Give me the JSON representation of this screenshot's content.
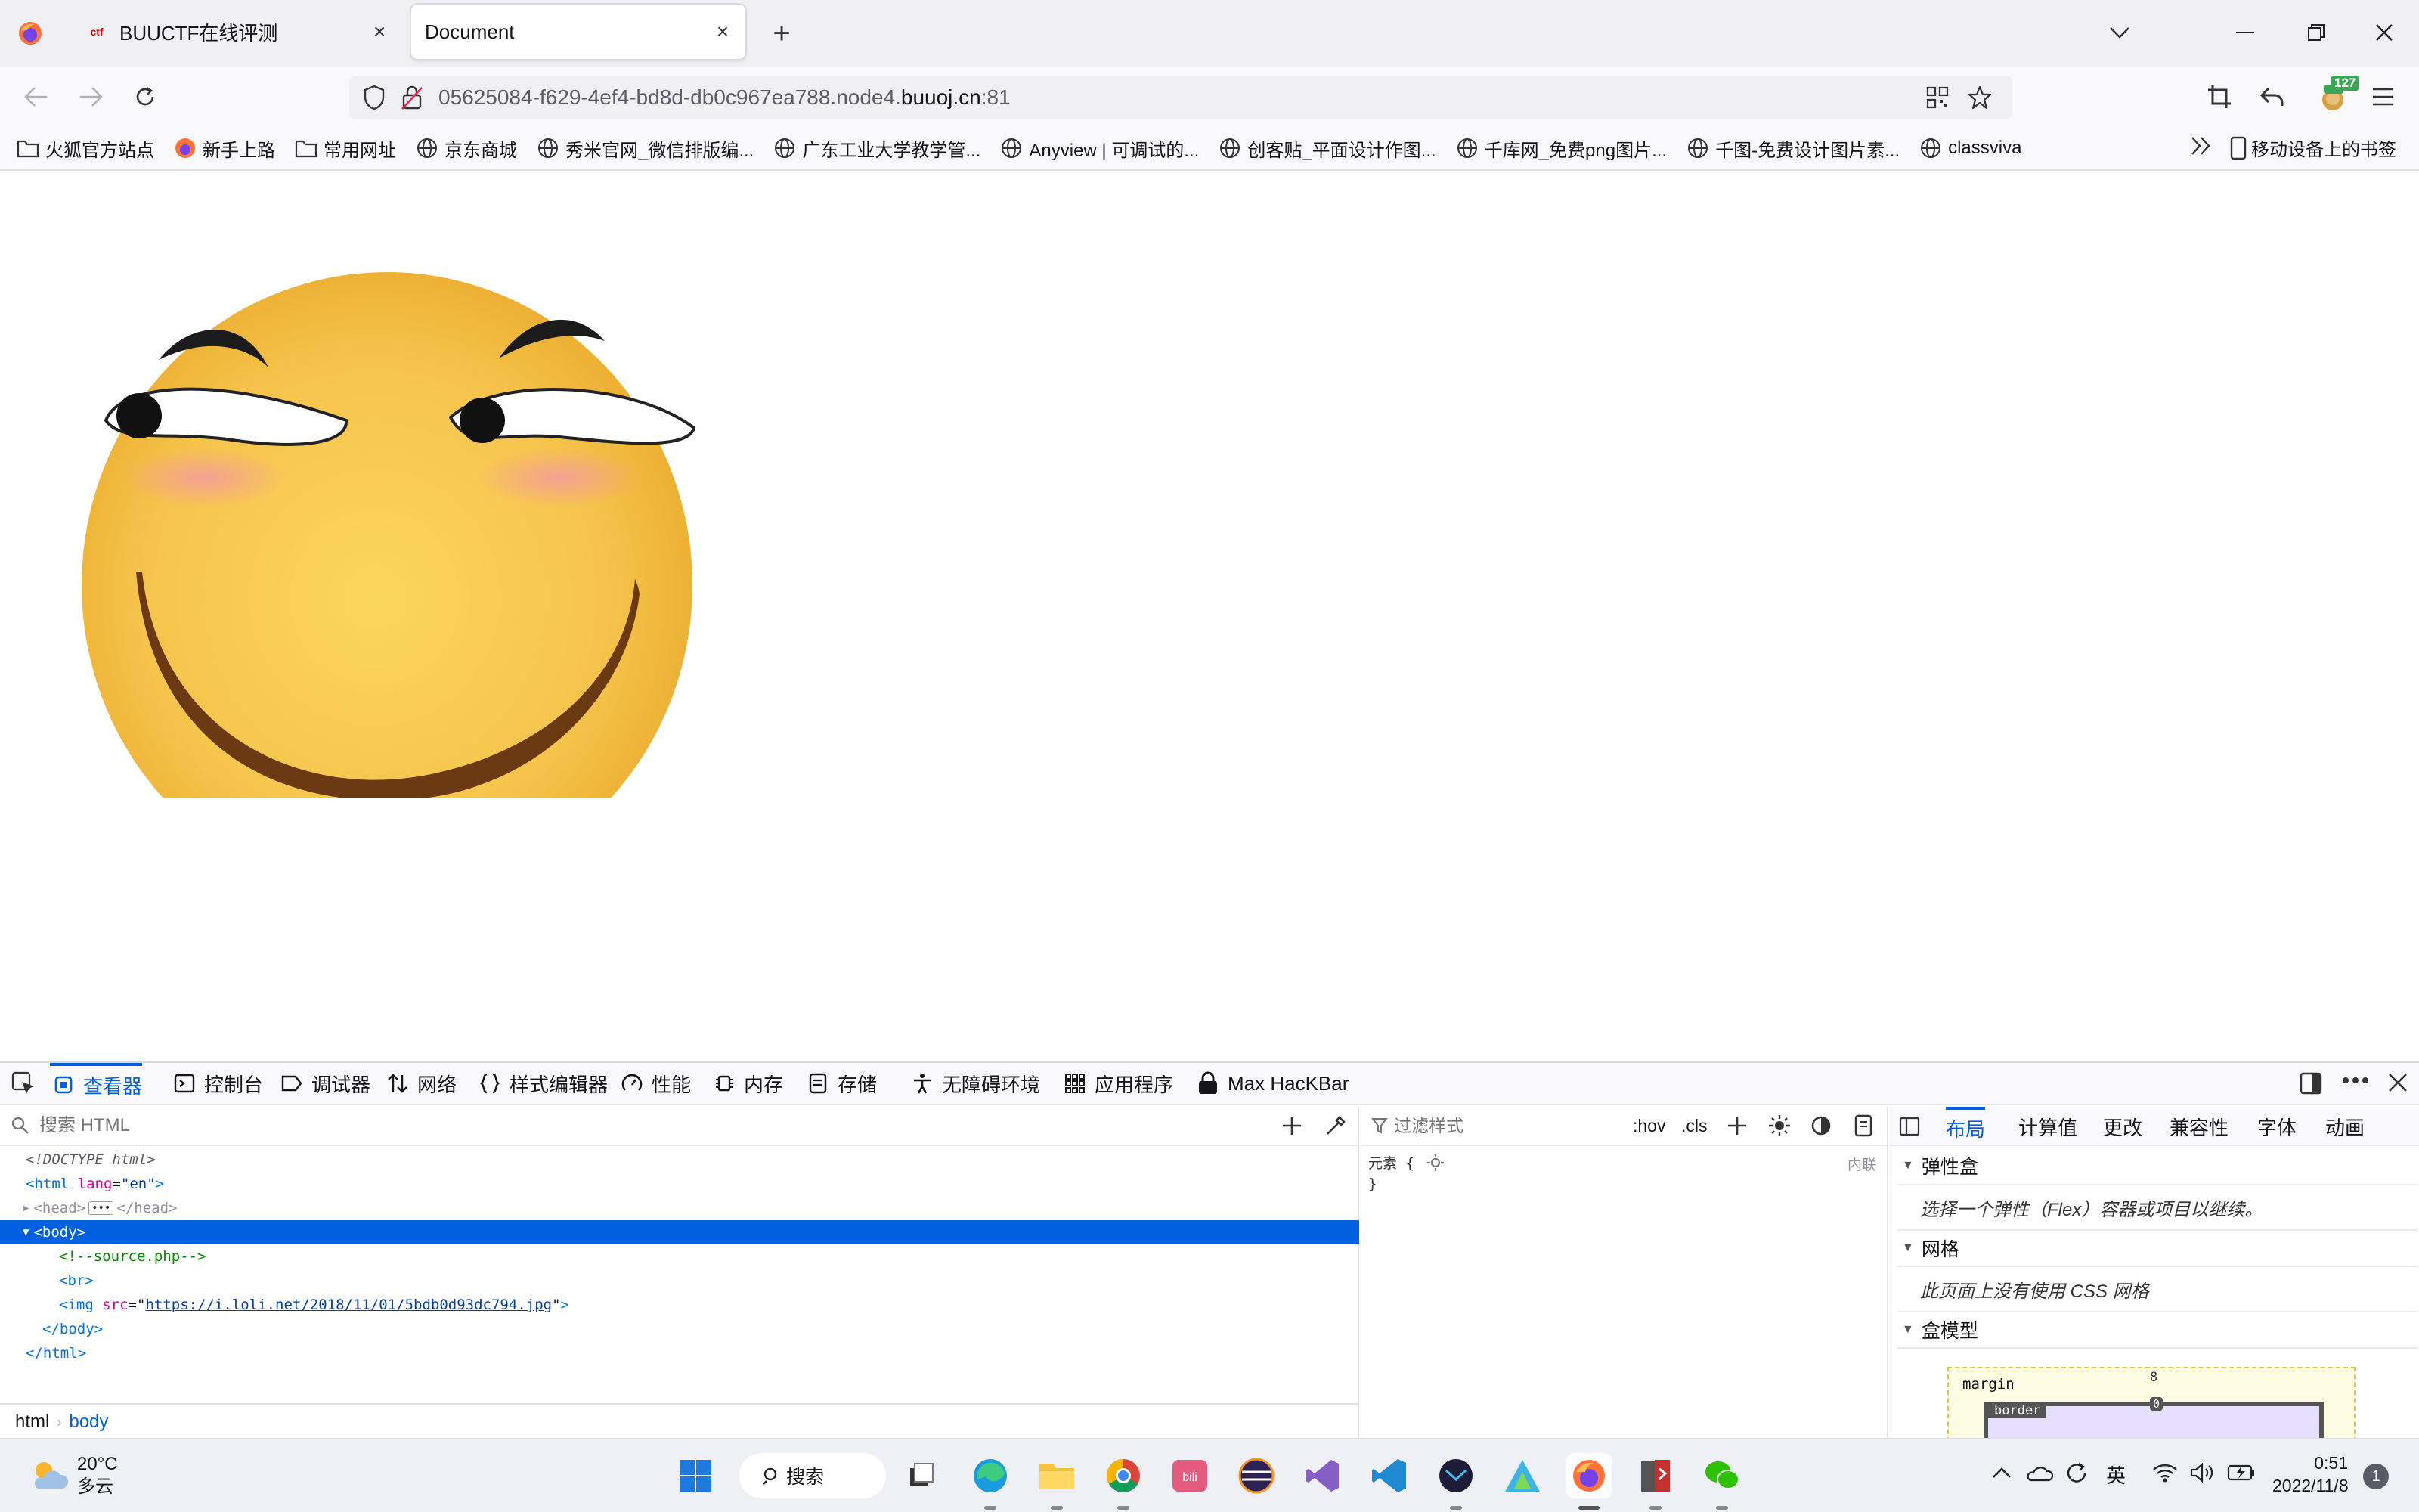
{
  "browser": {
    "tabs": [
      {
        "title": "BUUCTF在线评测",
        "active": false
      },
      {
        "title": "Document",
        "active": true
      }
    ],
    "url": {
      "prefix": "05625084-f629-4ef4-bd8d-db0c967ea788.node4.",
      "domain": "buuoj.cn",
      "port": ":81"
    },
    "extension_badge": "127",
    "bookmarks": [
      {
        "label": "火狐官方站点",
        "icon": "folder-icon"
      },
      {
        "label": "新手上路",
        "icon": "firefox-icon"
      },
      {
        "label": "常用网址",
        "icon": "folder-icon"
      },
      {
        "label": "京东商城",
        "icon": "globe-icon"
      },
      {
        "label": "秀米官网_微信排版编...",
        "icon": "globe-icon"
      },
      {
        "label": "广东工业大学教学管...",
        "icon": "globe-icon"
      },
      {
        "label": "Anyview | 可调试的...",
        "icon": "globe-icon"
      },
      {
        "label": "创客贴_平面设计作图...",
        "icon": "globe-icon"
      },
      {
        "label": "千库网_免费png图片...",
        "icon": "globe-icon"
      },
      {
        "label": "千图-免费设计图片素...",
        "icon": "globe-icon"
      },
      {
        "label": "classviva",
        "icon": "globe-icon"
      }
    ],
    "mobile_bookmarks": "移动设备上的书签"
  },
  "devtools": {
    "tabs": [
      {
        "label": "查看器",
        "icon": "inspector-icon",
        "active": true
      },
      {
        "label": "控制台",
        "icon": "console-icon"
      },
      {
        "label": "调试器",
        "icon": "debugger-icon"
      },
      {
        "label": "网络",
        "icon": "network-icon"
      },
      {
        "label": "样式编辑器",
        "icon": "braces-icon"
      },
      {
        "label": "性能",
        "icon": "gauge-icon"
      },
      {
        "label": "内存",
        "icon": "chip-icon"
      },
      {
        "label": "存储",
        "icon": "storage-icon"
      },
      {
        "label": "无障碍环境",
        "icon": "accessibility-icon"
      },
      {
        "label": "应用程序",
        "icon": "grid-icon"
      },
      {
        "label": "Max HacKBar",
        "icon": "lock-icon"
      }
    ],
    "search_placeholder": "搜索 HTML",
    "html_tree": {
      "doctype": "<!DOCTYPE html>",
      "html_open_tag": "<html",
      "html_attr_name": "lang",
      "html_attr_value": "\"en\"",
      "head": "<head>",
      "head_close": "</head>",
      "body_open": "<body>",
      "comment": "<!--source.php-->",
      "br": "<br>",
      "img_tag": "<img",
      "img_attr": "src",
      "img_src": "https://i.loli.net/2018/11/01/5bdb0d93dc794.jpg",
      "body_close": "</body>",
      "html_close": "</html>"
    },
    "breadcrumbs": [
      "html",
      "body"
    ],
    "styles": {
      "filter_placeholder": "过滤样式",
      "hov": ":hov",
      "cls": ".cls",
      "rule_selector": "元素 {",
      "rule_close": "}",
      "inline_label": "内联"
    },
    "layout": {
      "tabs": [
        "布局",
        "计算值",
        "更改",
        "兼容性",
        "字体",
        "动画"
      ],
      "flex_title": "弹性盒",
      "flex_text": "选择一个弹性（Flex）容器或项目以继续。",
      "grid_title": "网格",
      "grid_text": "此页面上没有使用 CSS 网格",
      "box_title": "盒模型",
      "box_margin_label": "margin",
      "box_margin_value": "8",
      "box_border_label": "border",
      "box_border_value": "0"
    }
  },
  "taskbar": {
    "weather_temp": "20°C",
    "weather_desc": "多云",
    "search_label": "搜索",
    "ime": "英",
    "time": "0:51",
    "date": "2022/11/8",
    "notification_count": "1"
  }
}
